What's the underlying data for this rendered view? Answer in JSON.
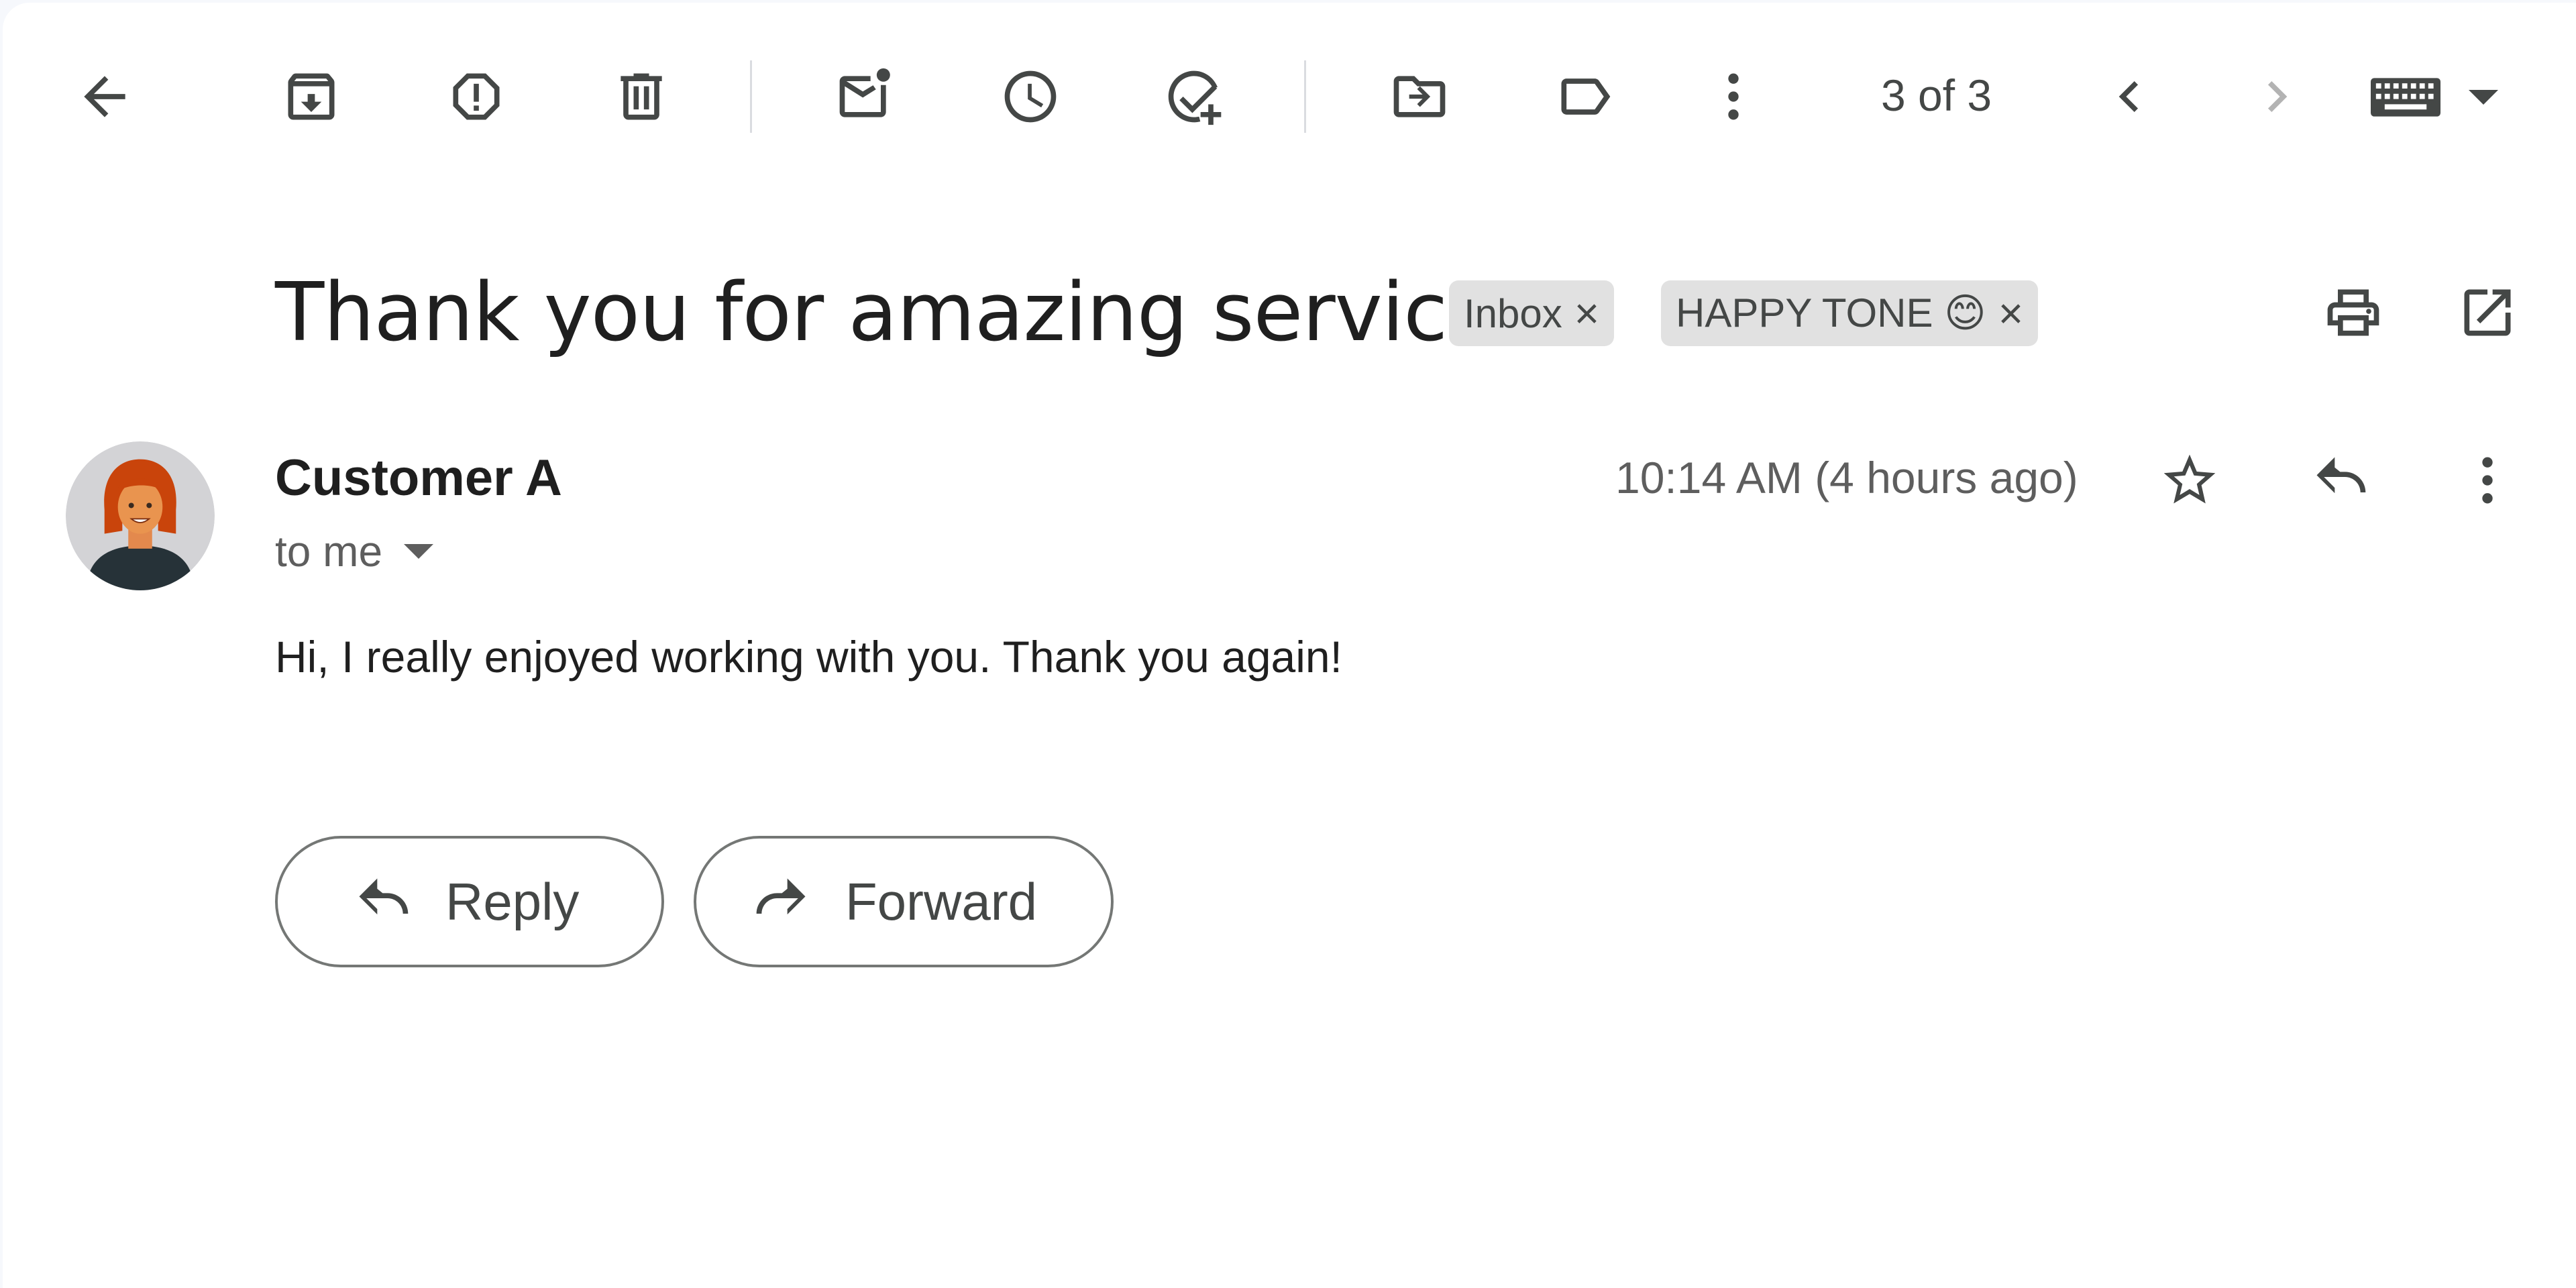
{
  "toolbar": {
    "counter": "3 of 3",
    "icons": {
      "back": "arrow-left-icon",
      "archive": "archive-icon",
      "spam": "report-spam-icon",
      "delete": "trash-icon",
      "unread": "mark-unread-icon",
      "snooze": "clock-icon",
      "task": "add-task-icon",
      "move": "move-to-folder-icon",
      "label": "label-icon",
      "more": "more-vert-icon",
      "prev": "chevron-left-icon",
      "next": "chevron-right-icon",
      "keyboard": "keyboard-icon"
    }
  },
  "email": {
    "subject": "Thank you for amazing service!",
    "labels": [
      {
        "name": "Inbox",
        "remove": "×"
      },
      {
        "name": "HAPPY TONE 😊",
        "remove": "×"
      }
    ],
    "sender": "Customer A",
    "recipient": "to me",
    "timestamp": "10:14 AM (4 hours ago)",
    "body": "Hi, I really enjoyed working with you. Thank you again!"
  },
  "actions": {
    "reply_label": "Reply",
    "forward_label": "Forward"
  },
  "colors": {
    "chip_bg": "#e1e1e1",
    "icon": "#444746",
    "disabled_icon": "#b3b3b3",
    "avatar_hair": "#c9440b",
    "avatar_bg": "#d3d3d6"
  }
}
